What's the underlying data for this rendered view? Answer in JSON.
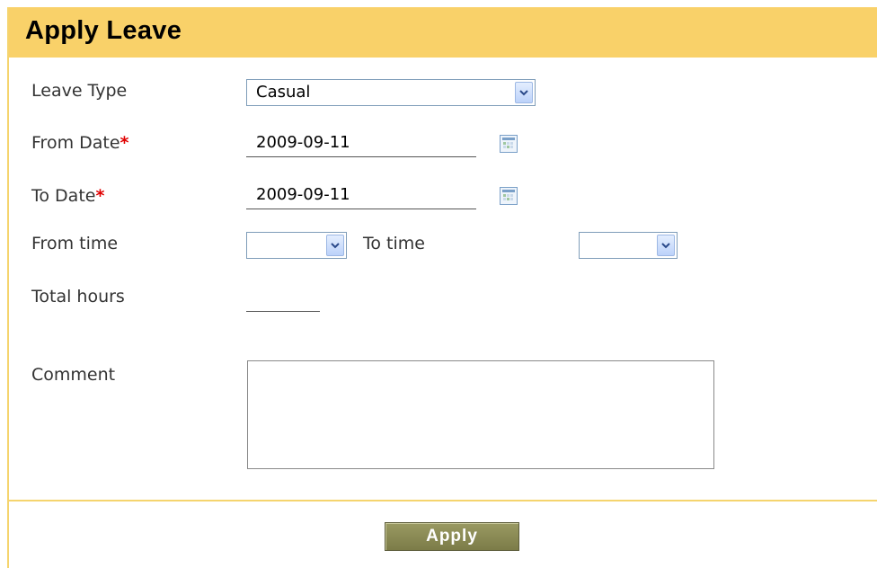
{
  "header": {
    "title": "Apply Leave"
  },
  "form": {
    "leave_type": {
      "label": "Leave Type",
      "value": "Casual"
    },
    "from_date": {
      "label": "From Date",
      "required_mark": "*",
      "value": "2009-09-11"
    },
    "to_date": {
      "label": "To Date",
      "required_mark": "*",
      "value": "2009-09-11"
    },
    "from_time": {
      "label": "From time",
      "value": ""
    },
    "to_time": {
      "label": "To time",
      "value": ""
    },
    "total_hours": {
      "label": "Total hours",
      "value": ""
    },
    "comment": {
      "label": "Comment",
      "value": ""
    }
  },
  "actions": {
    "apply_label": "Apply"
  },
  "colors": {
    "header_bg": "#f9d169",
    "border": "#f5d46e",
    "button": "#8a8a55",
    "required": "#e00000"
  }
}
